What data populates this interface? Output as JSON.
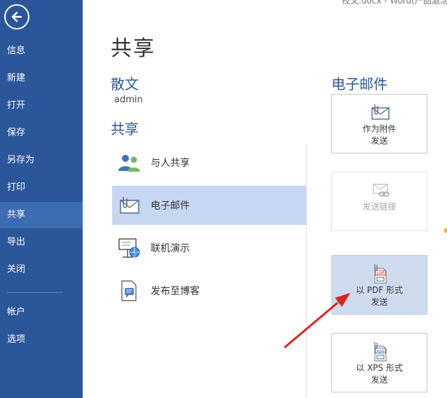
{
  "window": {
    "title_fragment": "校文.docx - Word(产品激活"
  },
  "sidebar": {
    "items": [
      {
        "label": "信息"
      },
      {
        "label": "新建"
      },
      {
        "label": "打开"
      },
      {
        "label": "保存"
      },
      {
        "label": "另存为"
      },
      {
        "label": "打印"
      },
      {
        "label": "共享",
        "active": true
      },
      {
        "label": "导出"
      },
      {
        "label": "关闭"
      },
      {
        "label": "帐户"
      },
      {
        "label": "选项"
      }
    ]
  },
  "main": {
    "title": "共享",
    "document_name": "散文",
    "author": "admin",
    "share_heading": "共享",
    "share_items": [
      {
        "label": "与人共享",
        "icon": "people-icon"
      },
      {
        "label": "电子邮件",
        "icon": "email-icon",
        "selected": true
      },
      {
        "label": "联机演示",
        "icon": "presentation-icon"
      },
      {
        "label": "发布至博客",
        "icon": "blog-icon"
      }
    ]
  },
  "email_panel": {
    "heading": "电子邮件",
    "options": [
      {
        "line1": "作为附件",
        "line2": "发送",
        "icon": "attachment-icon"
      },
      {
        "line1": "发送链接",
        "line2": "",
        "icon": "link-icon",
        "disabled": true
      },
      {
        "line1": "以 PDF 形式",
        "line2": "发送",
        "icon": "pdf-icon",
        "highlighted": true,
        "icon_text": "pdf"
      },
      {
        "line1": "以 XPS 形式",
        "line2": "发送",
        "icon": "xps-icon",
        "icon_text": "xps"
      }
    ]
  },
  "colors": {
    "sidebar": "#2b579a",
    "accent_blue": "#2b579a",
    "selected": "#c5d7f1",
    "arrow": "#d9261c"
  }
}
